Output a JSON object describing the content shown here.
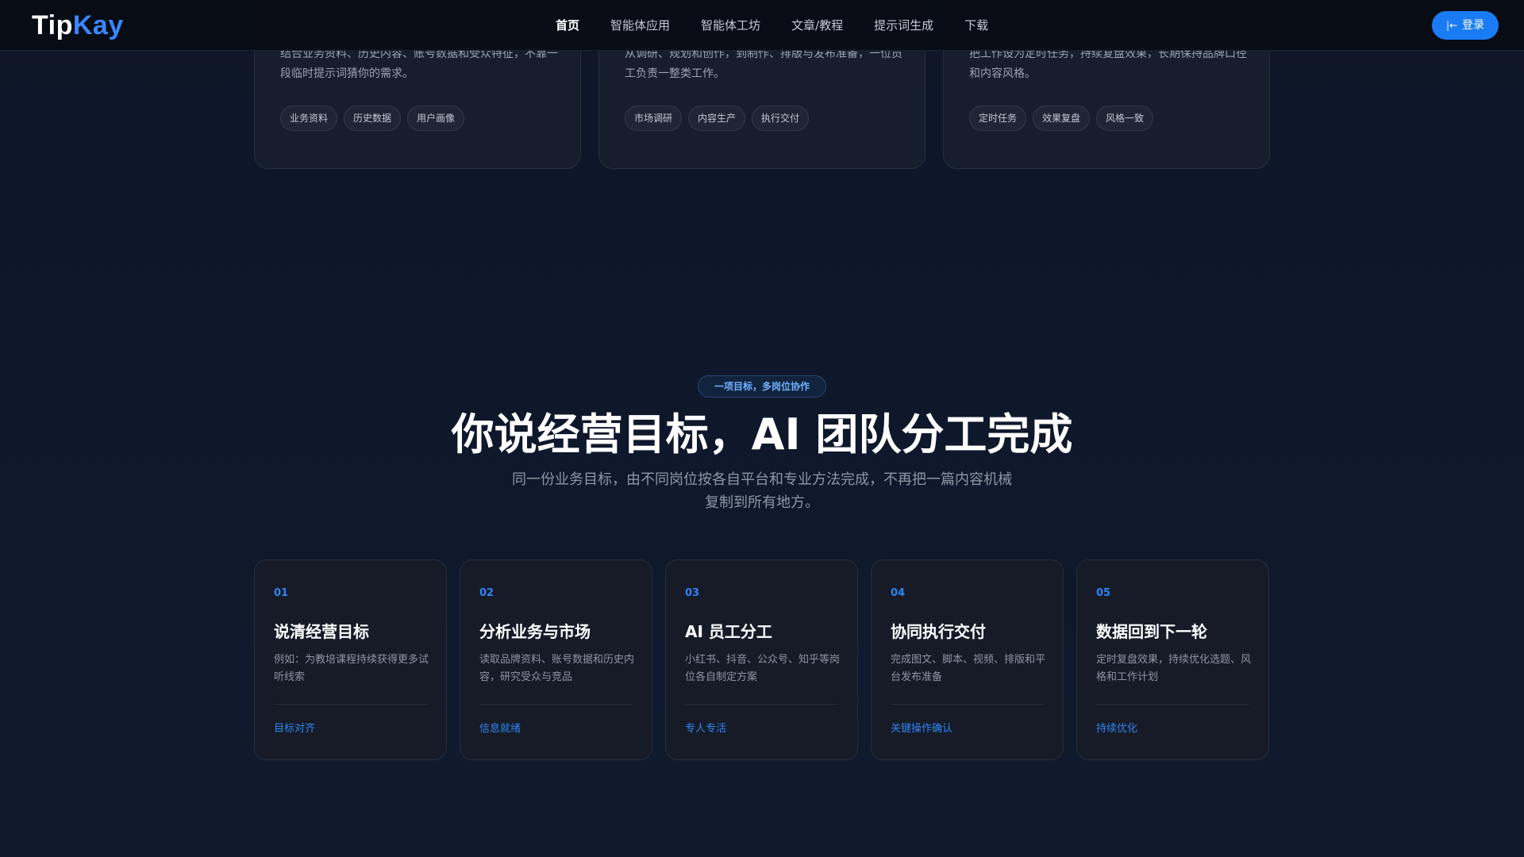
{
  "header": {
    "logo_part1": "Tip",
    "logo_part2": "Kay",
    "nav": [
      "首页",
      "智能体应用",
      "智能体工坊",
      "文章/教程",
      "提示词生成",
      "下载"
    ],
    "active_nav": "首页",
    "login_label": "登录",
    "login_icon": "login-icon"
  },
  "features": [
    {
      "desc": "结合业务资料、历史内容、账号数据和受众特征，不靠一段临时提示词猜你的需求。",
      "tags": [
        "业务资料",
        "历史数据",
        "用户画像"
      ]
    },
    {
      "desc": "从调研、规划和创作，到制作、排版与发布准备，一位员工负责一整类工作。",
      "tags": [
        "市场调研",
        "内容生产",
        "执行交付"
      ]
    },
    {
      "desc": "把工作设为定时任务，持续复盘效果，长期保持品牌口径和内容风格。",
      "tags": [
        "定时任务",
        "效果复盘",
        "风格一致"
      ]
    }
  ],
  "section": {
    "pill": "一项目标，多岗位协作",
    "title": "你说经营目标，AI 团队分工完成",
    "subtitle": "同一份业务目标，由不同岗位按各自平台和专业方法完成，不再把一篇内容机械复制到所有地方。"
  },
  "steps": [
    {
      "num": "01",
      "title": "说清经营目标",
      "desc": "例如：为教培课程持续获得更多试听线索",
      "link": "目标对齐"
    },
    {
      "num": "02",
      "title": "分析业务与市场",
      "desc": "读取品牌资料、账号数据和历史内容，研究受众与竞品",
      "link": "信息就绪"
    },
    {
      "num": "03",
      "title": "AI 员工分工",
      "desc": "小红书、抖音、公众号、知乎等岗位各自制定方案",
      "link": "专人专活"
    },
    {
      "num": "04",
      "title": "协同执行交付",
      "desc": "完成图文、脚本、视频、排版和平台发布准备",
      "link": "关键操作确认"
    },
    {
      "num": "05",
      "title": "数据回到下一轮",
      "desc": "定时复盘效果，持续优化选题、风格和工作计划",
      "link": "持续优化"
    }
  ],
  "colors": {
    "accent": "#1a7cf5",
    "step_number": "#2f84f5",
    "background": "#0e1628"
  }
}
